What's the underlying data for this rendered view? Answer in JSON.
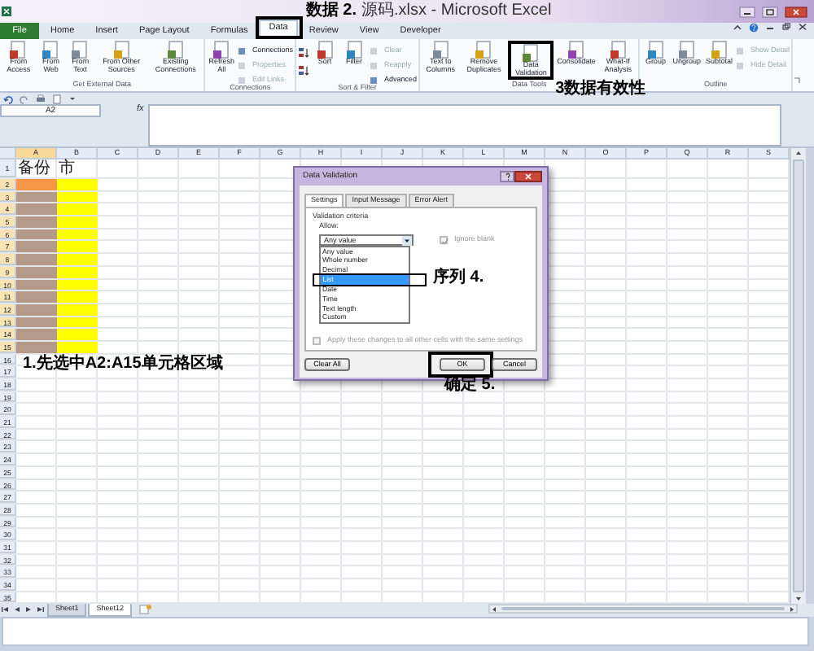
{
  "window": {
    "title": "源码.xlsx - Microsoft Excel"
  },
  "ribbon_tabs": [
    {
      "label": "File",
      "kind": "file",
      "selected": false
    },
    {
      "label": "Home",
      "kind": "tab",
      "selected": false
    },
    {
      "label": "Insert",
      "kind": "tab",
      "selected": false
    },
    {
      "label": "Page Layout",
      "kind": "tab",
      "selected": false
    },
    {
      "label": "Formulas",
      "kind": "tab",
      "selected": false
    },
    {
      "label": "Data",
      "kind": "tab",
      "selected": true,
      "outlined": true,
      "note": "数据 2."
    },
    {
      "label": "Review",
      "kind": "tab",
      "selected": false
    },
    {
      "label": "View",
      "kind": "tab",
      "selected": false
    },
    {
      "label": "Developer",
      "kind": "tab",
      "selected": false
    }
  ],
  "ribbon_groups": [
    {
      "label": "Get External Data",
      "items": [
        {
          "kind": "large",
          "label": "From Access"
        },
        {
          "kind": "large",
          "label": "From Web"
        },
        {
          "kind": "large",
          "label": "From Text"
        },
        {
          "kind": "large",
          "label": "From Other Sources"
        },
        {
          "kind": "large",
          "label": "Existing Connections"
        }
      ]
    },
    {
      "label": "Connections",
      "items": [
        {
          "kind": "large",
          "label": "Refresh All"
        },
        {
          "kind": "stack",
          "entries": [
            {
              "label": "Connections",
              "disabled": false
            },
            {
              "label": "Properties",
              "disabled": true
            },
            {
              "label": "Edit Links",
              "disabled": true
            }
          ]
        }
      ]
    },
    {
      "label": "Sort & Filter",
      "items": [
        {
          "kind": "sortpair"
        },
        {
          "kind": "large",
          "label": "Sort"
        },
        {
          "kind": "large",
          "label": "Filter"
        },
        {
          "kind": "stack",
          "entries": [
            {
              "label": "Clear",
              "disabled": true
            },
            {
              "label": "Reapply",
              "disabled": true
            },
            {
              "label": "Advanced",
              "disabled": false
            }
          ]
        }
      ]
    },
    {
      "label": "Data Tools",
      "items": [
        {
          "kind": "large",
          "label": "Text to Columns"
        },
        {
          "kind": "large",
          "label": "Remove Duplicates"
        },
        {
          "kind": "large",
          "label": "Data Validation",
          "outlined": true,
          "note": "3数据有效性"
        },
        {
          "kind": "large",
          "label": "Consolidate"
        },
        {
          "kind": "large",
          "label": "What-If Analysis"
        }
      ]
    },
    {
      "label": "Outline",
      "items": [
        {
          "kind": "large",
          "label": "Group"
        },
        {
          "kind": "large",
          "label": "Ungroup"
        },
        {
          "kind": "large",
          "label": "Subtotal"
        },
        {
          "kind": "stack",
          "entries": [
            {
              "label": "Show Detail",
              "disabled": true
            },
            {
              "label": "Hide Detail",
              "disabled": true
            }
          ]
        }
      ]
    }
  ],
  "formula_bar": {
    "name_box": "A2",
    "function_label": "fx"
  },
  "sheet": {
    "columns": [
      {
        "label": "A",
        "selected": true
      },
      {
        "label": "B",
        "selected": false
      },
      {
        "label": "C",
        "selected": false
      },
      {
        "label": "D",
        "selected": false
      },
      {
        "label": "E",
        "selected": false
      },
      {
        "label": "F",
        "selected": false
      },
      {
        "label": "G",
        "selected": false
      },
      {
        "label": "H",
        "selected": false
      },
      {
        "label": "I",
        "selected": false
      },
      {
        "label": "J",
        "selected": false
      },
      {
        "label": "K",
        "selected": false
      },
      {
        "label": "L",
        "selected": false
      },
      {
        "label": "M",
        "selected": false
      },
      {
        "label": "N",
        "selected": false
      },
      {
        "label": "O",
        "selected": false
      },
      {
        "label": "P",
        "selected": false
      },
      {
        "label": "Q",
        "selected": false
      },
      {
        "label": "R",
        "selected": false
      },
      {
        "label": "S",
        "selected": false
      }
    ],
    "rows": [
      {
        "label": "1",
        "selected": false,
        "cells": [
          {
            "text": "备份"
          },
          {
            "text": "市"
          }
        ]
      },
      {
        "label": "2",
        "selected": true,
        "cells": [
          {
            "color": "#f79646"
          },
          {
            "color": "#ffff00"
          }
        ]
      },
      {
        "label": "3",
        "selected": true,
        "cells": [
          {
            "color": "#b39a8b"
          },
          {
            "color": "#ffff00"
          }
        ]
      },
      {
        "label": "4",
        "selected": true,
        "cells": [
          {
            "color": "#b39a8b"
          },
          {
            "color": "#ffff00"
          }
        ]
      },
      {
        "label": "5",
        "selected": true,
        "cells": [
          {
            "color": "#b39a8b"
          },
          {
            "color": "#ffff00"
          }
        ]
      },
      {
        "label": "6",
        "selected": true,
        "cells": [
          {
            "color": "#b39a8b"
          },
          {
            "color": "#ffff00"
          }
        ]
      },
      {
        "label": "7",
        "selected": true,
        "cells": [
          {
            "color": "#b39a8b"
          },
          {
            "color": "#ffff00"
          }
        ]
      },
      {
        "label": "8",
        "selected": true,
        "cells": [
          {
            "color": "#b39a8b"
          },
          {
            "color": "#ffff00"
          }
        ]
      },
      {
        "label": "9",
        "selected": true,
        "cells": [
          {
            "color": "#b39a8b"
          },
          {
            "color": "#ffff00"
          }
        ]
      },
      {
        "label": "10",
        "selected": true,
        "cells": [
          {
            "color": "#b39a8b"
          },
          {
            "color": "#ffff00"
          }
        ]
      },
      {
        "label": "11",
        "selected": true,
        "cells": [
          {
            "color": "#b39a8b"
          },
          {
            "color": "#ffff00"
          }
        ]
      },
      {
        "label": "12",
        "selected": true,
        "cells": [
          {
            "color": "#b39a8b"
          },
          {
            "color": "#ffff00"
          }
        ]
      },
      {
        "label": "13",
        "selected": true,
        "cells": [
          {
            "color": "#b39a8b"
          },
          {
            "color": "#ffff00"
          }
        ]
      },
      {
        "label": "14",
        "selected": true,
        "cells": [
          {
            "color": "#b39a8b"
          },
          {
            "color": "#ffff00"
          }
        ]
      },
      {
        "label": "15",
        "selected": true,
        "cells": [
          {
            "color": "#b39a8b"
          },
          {
            "color": "#ffff00"
          }
        ]
      },
      {
        "label": "16",
        "selected": false,
        "note": "1.先选中A2:A15单元格区域"
      },
      {
        "label": "17",
        "selected": false
      },
      {
        "label": "18",
        "selected": false
      },
      {
        "label": "19",
        "selected": false
      },
      {
        "label": "20",
        "selected": false
      },
      {
        "label": "21",
        "selected": false
      },
      {
        "label": "22",
        "selected": false
      },
      {
        "label": "23",
        "selected": false
      },
      {
        "label": "24",
        "selected": false
      },
      {
        "label": "25",
        "selected": false
      },
      {
        "label": "26",
        "selected": false
      },
      {
        "label": "27",
        "selected": false
      },
      {
        "label": "28",
        "selected": false
      },
      {
        "label": "29",
        "selected": false
      },
      {
        "label": "30",
        "selected": false
      },
      {
        "label": "31",
        "selected": false
      },
      {
        "label": "32",
        "selected": false
      },
      {
        "label": "33",
        "selected": false
      },
      {
        "label": "34",
        "selected": false
      },
      {
        "label": "35",
        "selected": false
      }
    ]
  },
  "sheet_tabs": [
    {
      "label": "Sheet1",
      "selected": false
    },
    {
      "label": "Sheet12",
      "selected": true
    }
  ],
  "dialog": {
    "title": "Data Validation",
    "tabs": [
      {
        "label": "Settings",
        "selected": true
      },
      {
        "label": "Input Message",
        "selected": false
      },
      {
        "label": "Error Alert",
        "selected": false
      }
    ],
    "section": "Validation criteria",
    "allow_label": "Allow:",
    "allow_value": "Any value",
    "options": [
      {
        "label": "Any value",
        "selected": false
      },
      {
        "label": "Whole number",
        "selected": false
      },
      {
        "label": "Decimal",
        "selected": false
      },
      {
        "label": "List",
        "selected": true,
        "outlined": true,
        "note": "序列 4."
      },
      {
        "label": "Date",
        "selected": false
      },
      {
        "label": "Time",
        "selected": false
      },
      {
        "label": "Text length",
        "selected": false
      },
      {
        "label": "Custom",
        "selected": false
      }
    ],
    "ignore_blank": {
      "label": "Ignore blank",
      "checked": true,
      "disabled": true
    },
    "apply_all": {
      "label": "Apply these changes to all other cells with the same settings",
      "checked": false,
      "disabled": true
    },
    "buttons": [
      {
        "label": "Clear All",
        "kind": "left"
      },
      {
        "label": "OK",
        "kind": "right",
        "outlined": true,
        "note": "确定 5."
      },
      {
        "label": "Cancel",
        "kind": "right"
      }
    ]
  }
}
